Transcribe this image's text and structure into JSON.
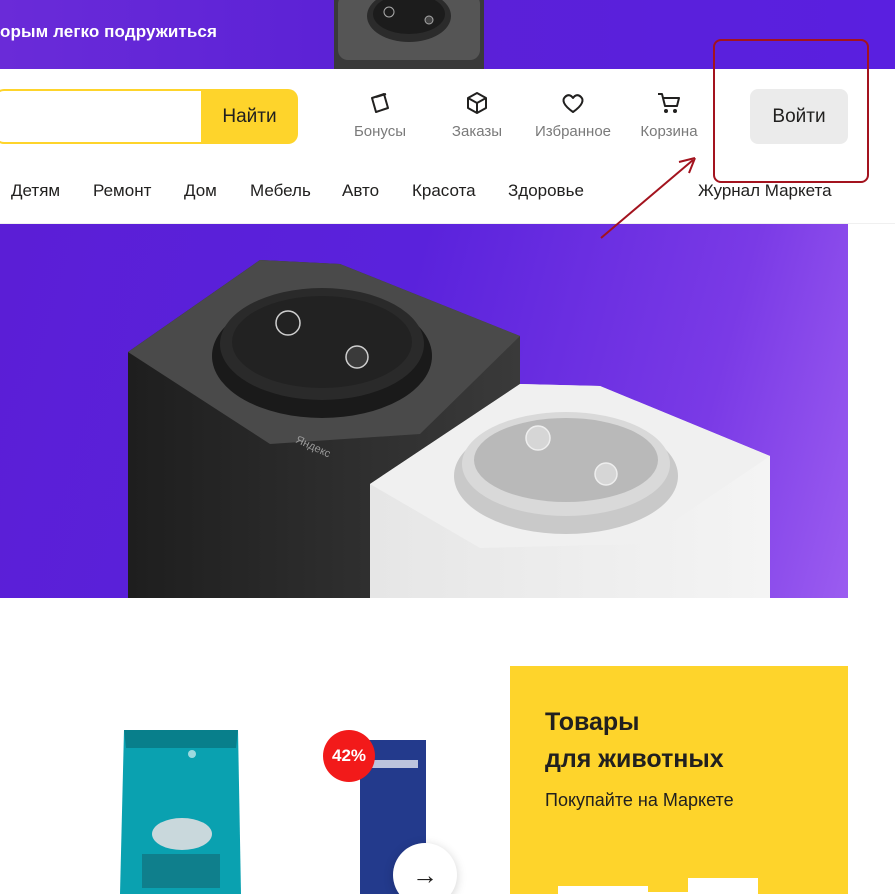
{
  "promo": {
    "text": "орым легко подружиться"
  },
  "search": {
    "placeholder": "",
    "button_label": "Найти"
  },
  "nav": {
    "bonuses": "Бонусы",
    "orders": "Заказы",
    "favorites": "Избранное",
    "cart": "Корзина"
  },
  "login": {
    "label": "Войти"
  },
  "categories": [
    "Детям",
    "Ремонт",
    "Дом",
    "Мебель",
    "Авто",
    "Красота",
    "Здоровье"
  ],
  "journal": "Журнал Маркета",
  "hero": {
    "speaker_brand": "Яндекс"
  },
  "products": {
    "discount": "42%",
    "next_icon": "arrow-right-icon"
  },
  "pet_promo": {
    "title_line1": "Товары",
    "title_line2": "для животных",
    "subtitle": "Покупайте на Маркете"
  },
  "colors": {
    "accent_yellow": "#fed42b",
    "purple": "#5b21d6",
    "annotation_red": "#a3131e",
    "discount_red": "#f21a1a"
  }
}
